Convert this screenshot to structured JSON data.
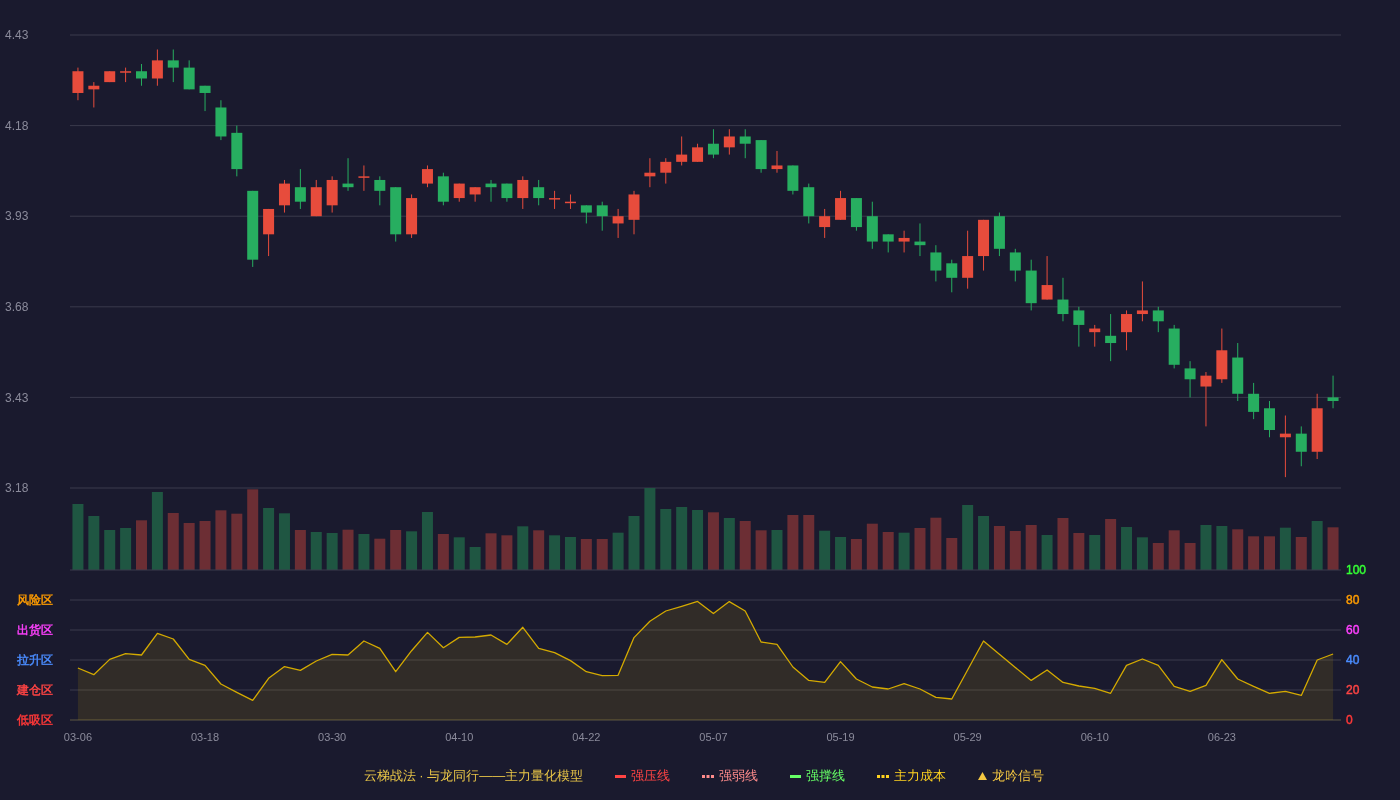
{
  "price_chart": {
    "chart_data": {
      "type": "candlestick",
      "grid": true,
      "ylim": [
        3.18,
        4.43
      ],
      "yticks": [
        4.43,
        4.18,
        3.93,
        3.68,
        3.43,
        3.18
      ],
      "categories": [
        null,
        null,
        null,
        null,
        null,
        null,
        null,
        null,
        null,
        null,
        null,
        null,
        null,
        null,
        null,
        null,
        null,
        null,
        null,
        null,
        null,
        null,
        null,
        null,
        null,
        null,
        null,
        null,
        null,
        null,
        null,
        null,
        null,
        null,
        null,
        null,
        null,
        null,
        null,
        null,
        null,
        null,
        null,
        null,
        null,
        null,
        null,
        null,
        null,
        null,
        null,
        null,
        null,
        null,
        null,
        null,
        null,
        null,
        null,
        null,
        null,
        null,
        null,
        null,
        null,
        null,
        null,
        null,
        null,
        null,
        null,
        null,
        null,
        null,
        null,
        null,
        null,
        null,
        null,
        null
      ],
      "ohlc": [
        [
          4.27,
          4.34,
          4.25,
          4.33
        ],
        [
          4.28,
          4.3,
          4.23,
          4.29
        ],
        [
          4.3,
          4.33,
          4.3,
          4.33
        ],
        [
          4.33,
          4.34,
          4.3,
          4.33
        ],
        [
          4.33,
          4.35,
          4.29,
          4.31
        ],
        [
          4.31,
          4.39,
          4.29,
          4.36
        ],
        [
          4.36,
          4.39,
          4.3,
          4.34
        ],
        [
          4.34,
          4.36,
          4.28,
          4.28
        ],
        [
          4.29,
          4.29,
          4.22,
          4.27
        ],
        [
          4.23,
          4.25,
          4.14,
          4.15
        ],
        [
          4.16,
          4.18,
          4.04,
          4.06
        ],
        [
          4.0,
          4.0,
          3.79,
          3.81
        ],
        [
          3.88,
          3.95,
          3.82,
          3.95
        ],
        [
          3.96,
          4.03,
          3.94,
          4.02
        ],
        [
          4.01,
          4.06,
          3.95,
          3.97
        ],
        [
          3.93,
          4.03,
          3.93,
          4.01
        ],
        [
          3.96,
          4.04,
          3.94,
          4.03
        ],
        [
          4.02,
          4.09,
          4.0,
          4.01
        ],
        [
          4.04,
          4.07,
          4.0,
          4.04
        ],
        [
          4.03,
          4.04,
          3.96,
          4.0
        ],
        [
          4.01,
          4.01,
          3.86,
          3.88
        ],
        [
          3.88,
          3.99,
          3.87,
          3.98
        ],
        [
          4.02,
          4.07,
          4.01,
          4.06
        ],
        [
          4.04,
          4.05,
          3.96,
          3.97
        ],
        [
          3.98,
          4.02,
          3.97,
          4.02
        ],
        [
          3.99,
          4.01,
          3.97,
          4.01
        ],
        [
          4.02,
          4.03,
          3.97,
          4.01
        ],
        [
          4.02,
          4.02,
          3.97,
          3.98
        ],
        [
          3.98,
          4.04,
          3.95,
          4.03
        ],
        [
          4.01,
          4.03,
          3.96,
          3.98
        ],
        [
          3.98,
          4.0,
          3.95,
          3.98
        ],
        [
          3.97,
          3.99,
          3.95,
          3.97
        ],
        [
          3.96,
          3.96,
          3.91,
          3.94
        ],
        [
          3.96,
          3.97,
          3.89,
          3.93
        ],
        [
          3.91,
          3.95,
          3.87,
          3.93
        ],
        [
          3.92,
          4.0,
          3.88,
          3.99
        ],
        [
          4.04,
          4.09,
          4.01,
          4.05
        ],
        [
          4.05,
          4.09,
          4.02,
          4.08
        ],
        [
          4.08,
          4.15,
          4.07,
          4.1
        ],
        [
          4.08,
          4.13,
          4.08,
          4.12
        ],
        [
          4.13,
          4.17,
          4.09,
          4.1
        ],
        [
          4.12,
          4.17,
          4.1,
          4.15
        ],
        [
          4.15,
          4.17,
          4.09,
          4.13
        ],
        [
          4.14,
          4.14,
          4.05,
          4.06
        ],
        [
          4.06,
          4.11,
          4.05,
          4.07
        ],
        [
          4.07,
          4.07,
          3.99,
          4.0
        ],
        [
          4.01,
          4.02,
          3.91,
          3.93
        ],
        [
          3.9,
          3.95,
          3.87,
          3.93
        ],
        [
          3.92,
          4.0,
          3.92,
          3.98
        ],
        [
          3.98,
          3.98,
          3.89,
          3.9
        ],
        [
          3.93,
          3.97,
          3.84,
          3.86
        ],
        [
          3.88,
          3.88,
          3.83,
          3.86
        ],
        [
          3.86,
          3.89,
          3.83,
          3.87
        ],
        [
          3.86,
          3.91,
          3.82,
          3.85
        ],
        [
          3.83,
          3.85,
          3.75,
          3.78
        ],
        [
          3.8,
          3.81,
          3.72,
          3.76
        ],
        [
          3.76,
          3.89,
          3.73,
          3.82
        ],
        [
          3.82,
          3.92,
          3.78,
          3.92
        ],
        [
          3.93,
          3.94,
          3.82,
          3.84
        ],
        [
          3.83,
          3.84,
          3.75,
          3.78
        ],
        [
          3.78,
          3.81,
          3.67,
          3.69
        ],
        [
          3.7,
          3.82,
          3.7,
          3.74
        ],
        [
          3.7,
          3.76,
          3.64,
          3.66
        ],
        [
          3.67,
          3.68,
          3.57,
          3.63
        ],
        [
          3.61,
          3.63,
          3.57,
          3.62
        ],
        [
          3.6,
          3.66,
          3.53,
          3.58
        ],
        [
          3.61,
          3.67,
          3.56,
          3.66
        ],
        [
          3.66,
          3.75,
          3.64,
          3.67
        ],
        [
          3.67,
          3.68,
          3.61,
          3.64
        ],
        [
          3.62,
          3.63,
          3.51,
          3.52
        ],
        [
          3.51,
          3.53,
          3.43,
          3.48
        ],
        [
          3.46,
          3.5,
          3.35,
          3.49
        ],
        [
          3.48,
          3.62,
          3.47,
          3.56
        ],
        [
          3.54,
          3.58,
          3.42,
          3.44
        ],
        [
          3.44,
          3.47,
          3.37,
          3.39
        ],
        [
          3.4,
          3.42,
          3.32,
          3.34
        ],
        [
          3.32,
          3.38,
          3.21,
          3.33
        ],
        [
          3.33,
          3.35,
          3.24,
          3.28
        ],
        [
          3.28,
          3.44,
          3.26,
          3.4
        ],
        [
          3.43,
          3.49,
          3.4,
          3.42
        ]
      ]
    }
  },
  "indicator": {
    "levels": [
      {
        "color": "#33ff33"
      },
      {
        "label": "风险区",
        "color": "#ff9c00"
      },
      {
        "label": "出货区",
        "color": "#ff40ff"
      },
      {
        "label": "拉升区",
        "color": "#4a8cff"
      },
      {
        "label": "建仓区",
        "color": "#ff4444"
      },
      {
        "label": "低吸区",
        "color": "#ff3838"
      }
    ],
    "chart_data": {
      "type": "area",
      "grid": true,
      "ylim": [
        0,
        100
      ],
      "yticks": [
        100,
        80,
        60,
        40,
        20,
        0
      ],
      "categories": [
        "03-06",
        null,
        null,
        null,
        null,
        null,
        null,
        null,
        "03-18",
        null,
        null,
        null,
        null,
        null,
        null,
        null,
        "03-30",
        null,
        null,
        null,
        null,
        null,
        null,
        null,
        "04-10",
        null,
        null,
        null,
        null,
        null,
        null,
        null,
        "04-22",
        null,
        null,
        null,
        null,
        null,
        null,
        null,
        "05-07",
        null,
        null,
        null,
        null,
        null,
        null,
        null,
        "05-19",
        null,
        null,
        null,
        null,
        null,
        null,
        null,
        "05-29",
        null,
        null,
        null,
        null,
        null,
        null,
        null,
        "06-10",
        null,
        null,
        null,
        null,
        null,
        null,
        null,
        "06-23",
        null,
        null,
        null,
        null,
        null,
        null,
        null
      ],
      "series": [
        {
          "color": "#d4aa00",
          "values": [
            34.7,
            30.2,
            40.4,
            44.2,
            43.3,
            57.8,
            54,
            40.4,
            36.4,
            24,
            18.4,
            13.1,
            27.8,
            35.6,
            33.1,
            39.3,
            43.8,
            43.3,
            52.7,
            47.8,
            32.2,
            46.2,
            58.4,
            48.2,
            55.1,
            55.3,
            56.7,
            50.4,
            61.8,
            47.8,
            44.9,
            39.6,
            32.2,
            29.6,
            29.8,
            54.9,
            65.8,
            72.7,
            75.8,
            79.1,
            70.9,
            78.9,
            72.7,
            52,
            50.4,
            35.3,
            26.4,
            25.1,
            38.9,
            27.3,
            22,
            20.7,
            24.2,
            20.7,
            15.1,
            14,
            33.3,
            52.7,
            43.8,
            35.1,
            26.4,
            33.3,
            25.1,
            22.7,
            21.1,
            17.8,
            36.4,
            40.7,
            36.4,
            22.4,
            19.1,
            23.1,
            40.2,
            27.3,
            22.4,
            17.8,
            19.1,
            16.4,
            40,
            44
          ]
        }
      ]
    }
  },
  "legend": {
    "title": "云梯战法 · 与龙同行——主力量化模型",
    "items": [
      {
        "label": "强压线",
        "kind": "solid",
        "color": "#ff4444"
      },
      {
        "label": "强弱线",
        "kind": "dashed",
        "color": "#ff8c8c"
      },
      {
        "label": "强撑线",
        "kind": "solid",
        "color": "#66ff66"
      },
      {
        "label": "主力成本",
        "kind": "dashed",
        "color": "#ffd21f"
      },
      {
        "label": "龙吟信号",
        "kind": "triangle",
        "color": "#f5c842"
      }
    ]
  }
}
